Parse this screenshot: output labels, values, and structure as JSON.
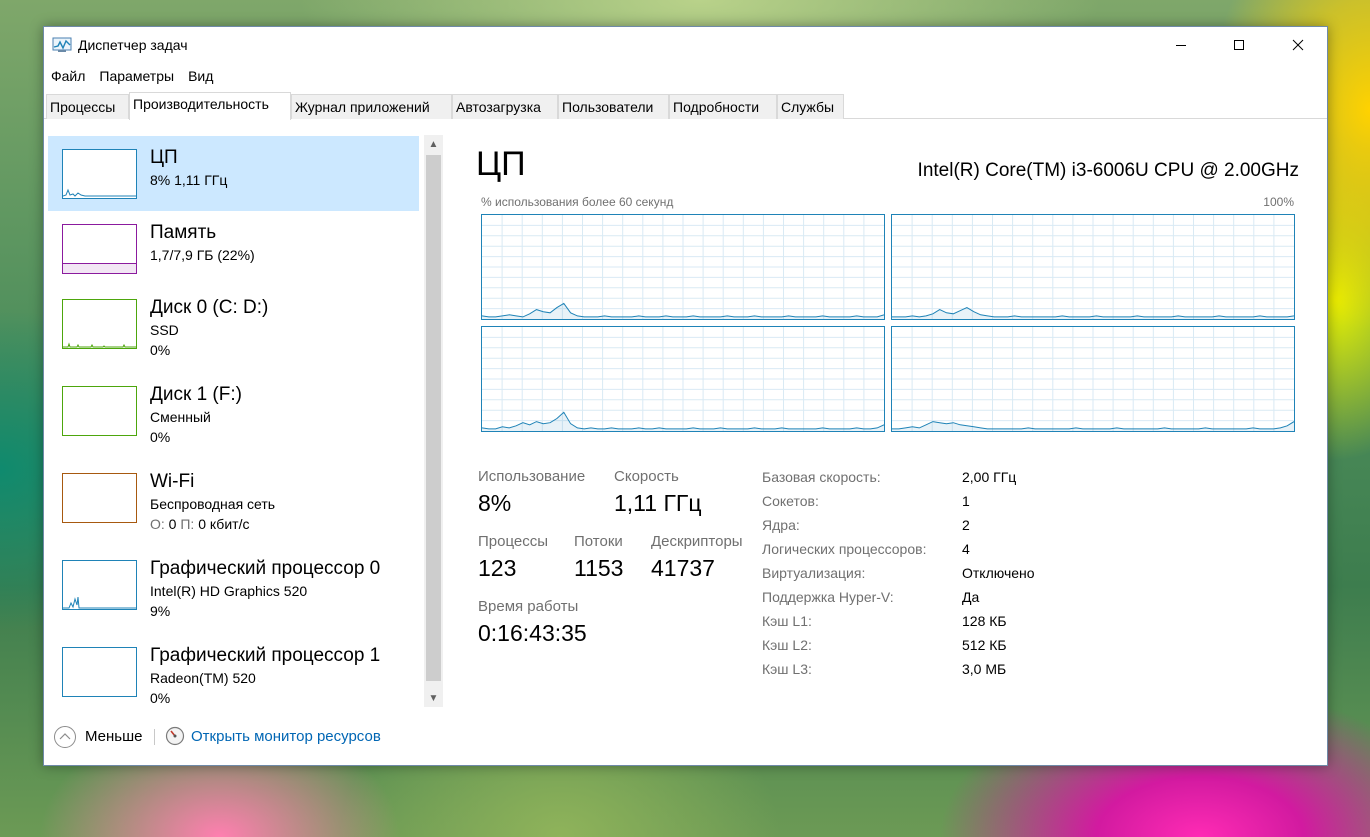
{
  "window": {
    "title": "Диспетчер задач"
  },
  "menu": [
    "Файл",
    "Параметры",
    "Вид"
  ],
  "tabs": [
    "Процессы",
    "Производительность",
    "Журнал приложений",
    "Автозагрузка",
    "Пользователи",
    "Подробности",
    "Службы"
  ],
  "active_tab": "Производительность",
  "sidebar": {
    "items": [
      {
        "title": "ЦП",
        "line2": "8% 1,11 ГГц",
        "line3": "",
        "color": "#1f83b7"
      },
      {
        "title": "Память",
        "line2": "1,7/7,9 ГБ (22%)",
        "line3": "",
        "color": "#8b1a9e"
      },
      {
        "title": "Диск 0 (C: D:)",
        "line2": "SSD",
        "line3": "0%",
        "color": "#4da60c"
      },
      {
        "title": "Диск 1 (F:)",
        "line2": "Сменный",
        "line3": "0%",
        "color": "#4da60c"
      },
      {
        "title": "Wi-Fi",
        "line2": "Беспроводная сеть",
        "line3_parts": {
          "o_label": "О:",
          "o_value": "0",
          "p_label": "П:",
          "p_value": "0 кбит/с"
        },
        "color": "#a7590f"
      },
      {
        "title": "Графический процессор 0",
        "line2": "Intel(R) HD Graphics 520",
        "line3": "9%",
        "color": "#1f83b7"
      },
      {
        "title": "Графический процессор 1",
        "line2": "Radeon(TM) 520",
        "line3": "0%",
        "color": "#1f83b7"
      }
    ]
  },
  "main": {
    "title": "ЦП",
    "cpu_name": "Intel(R) Core(TM) i3-6006U CPU @ 2.00GHz",
    "chart_caption": "% использования более 60 секунд",
    "chart_max": "100%",
    "graph_color": "#1f83b7",
    "stats": {
      "usage_label": "Использование",
      "usage_value": "8%",
      "speed_label": "Скорость",
      "speed_value": "1,11 ГГц",
      "processes_label": "Процессы",
      "processes_value": "123",
      "threads_label": "Потоки",
      "threads_value": "1153",
      "handles_label": "Дескрипторы",
      "handles_value": "41737",
      "uptime_label": "Время работы",
      "uptime_value": "0:16:43:35"
    },
    "properties": [
      {
        "label": "Базовая скорость:",
        "value": "2,00 ГГц"
      },
      {
        "label": "Сокетов:",
        "value": "1"
      },
      {
        "label": "Ядра:",
        "value": "2"
      },
      {
        "label": "Логических процессоров:",
        "value": "4"
      },
      {
        "label": "Виртуализация:",
        "value": "Отключено"
      },
      {
        "label": "Поддержка Hyper-V:",
        "value": "Да"
      },
      {
        "label": "Кэш L1:",
        "value": "128 КБ"
      },
      {
        "label": "Кэш L2:",
        "value": "512 КБ"
      },
      {
        "label": "Кэш L3:",
        "value": "3,0 МБ"
      }
    ]
  },
  "footer": {
    "fewer_label": "Меньше",
    "monitor_link": "Открыть монитор ресурсов"
  },
  "chart_data": {
    "type": "line",
    "ylim": [
      0,
      100
    ],
    "series": [
      {
        "values": [
          3,
          2,
          2,
          3,
          4,
          3,
          2,
          5,
          9,
          7,
          6,
          11,
          15,
          6,
          3,
          2,
          2,
          2,
          3,
          2,
          2,
          2,
          2,
          3,
          2,
          2,
          2,
          3,
          2,
          2,
          2,
          3,
          2,
          2,
          2,
          2,
          3,
          2,
          2,
          2,
          3,
          2,
          2,
          2,
          2,
          3,
          2,
          2,
          2,
          2,
          3,
          2,
          2,
          2,
          2,
          3,
          2,
          2,
          2,
          4
        ]
      },
      {
        "values": [
          2,
          2,
          2,
          3,
          2,
          3,
          5,
          9,
          6,
          5,
          8,
          11,
          7,
          4,
          3,
          2,
          2,
          2,
          3,
          2,
          2,
          2,
          2,
          2,
          2,
          3,
          2,
          2,
          2,
          2,
          3,
          2,
          2,
          2,
          2,
          2,
          3,
          2,
          2,
          2,
          2,
          2,
          3,
          2,
          2,
          2,
          2,
          2,
          3,
          2,
          2,
          2,
          2,
          2,
          3,
          2,
          2,
          2,
          2,
          3
        ]
      },
      {
        "values": [
          3,
          2,
          2,
          4,
          3,
          5,
          8,
          6,
          9,
          7,
          8,
          12,
          18,
          7,
          3,
          2,
          3,
          2,
          2,
          3,
          2,
          2,
          2,
          3,
          2,
          2,
          3,
          2,
          2,
          2,
          2,
          3,
          2,
          2,
          2,
          3,
          2,
          2,
          2,
          2,
          3,
          2,
          2,
          2,
          3,
          2,
          2,
          2,
          2,
          2,
          3,
          2,
          2,
          2,
          2,
          3,
          2,
          2,
          3,
          6
        ]
      },
      {
        "values": [
          2,
          2,
          3,
          4,
          3,
          6,
          9,
          8,
          7,
          8,
          6,
          5,
          4,
          3,
          2,
          2,
          2,
          2,
          2,
          2,
          3,
          2,
          2,
          2,
          2,
          2,
          2,
          3,
          2,
          2,
          2,
          2,
          2,
          3,
          2,
          2,
          2,
          2,
          2,
          2,
          3,
          2,
          2,
          2,
          2,
          2,
          3,
          2,
          2,
          2,
          2,
          2,
          2,
          3,
          2,
          2,
          2,
          3,
          5,
          9
        ]
      }
    ]
  }
}
